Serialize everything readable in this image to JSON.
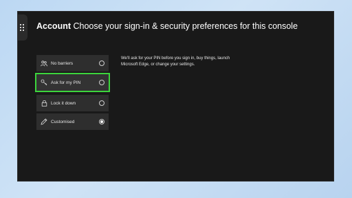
{
  "header": {
    "section": "Account",
    "title": "Choose your sign-in & security preferences for this console"
  },
  "options": [
    {
      "label": "No barriers",
      "icon": "people-icon",
      "selected": false,
      "focused": false
    },
    {
      "label": "Ask for my PIN",
      "icon": "key-icon",
      "selected": false,
      "focused": true
    },
    {
      "label": "Lock it down",
      "icon": "lock-icon",
      "selected": false,
      "focused": false
    },
    {
      "label": "Customised",
      "icon": "pencil-icon",
      "selected": true,
      "focused": false
    }
  ],
  "description": "We'll ask for your PIN before you sign in, buy things, launch Microsoft Edge, or change your settings.",
  "colors": {
    "focus_outline": "#3cd63c",
    "background": "#191919",
    "option_background": "#2e2e2e"
  }
}
